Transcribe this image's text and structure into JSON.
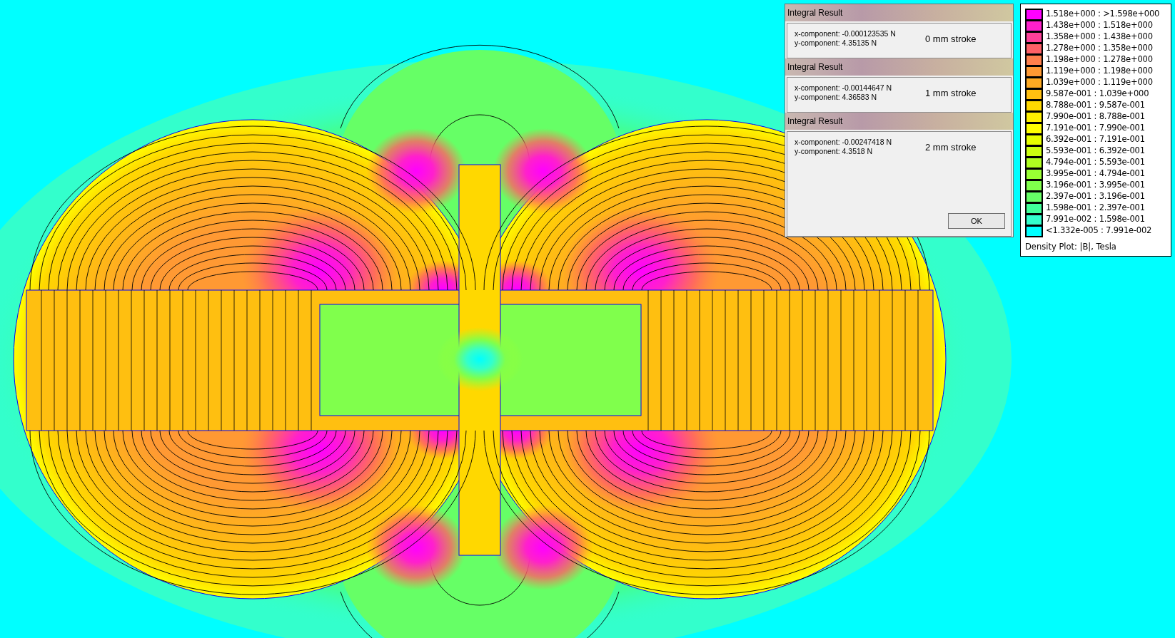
{
  "dialogs": [
    {
      "title": "Integral Result",
      "x_component": "x-component: -0.000123535 N",
      "y_component": "y-component: 4.35135 N",
      "note": "0 mm stroke"
    },
    {
      "title": "Integral Result",
      "x_component": "x-component: -0.00144647 N",
      "y_component": "y-component: 4.36583 N",
      "note": "1 mm stroke"
    },
    {
      "title": "Integral Result",
      "x_component": "x-component: -0.00247418 N",
      "y_component": "y-component: 4.3518 N",
      "note": "2 mm stroke",
      "button": "OK"
    }
  ],
  "legend": {
    "entries": [
      {
        "range": "1.518e+000 : >1.598e+000",
        "color": "#ff00ff"
      },
      {
        "range": "1.438e+000 : 1.518e+000",
        "color": "#ff20cc"
      },
      {
        "range": "1.358e+000 : 1.438e+000",
        "color": "#ff4099"
      },
      {
        "range": "1.278e+000 : 1.358e+000",
        "color": "#ff6066"
      },
      {
        "range": "1.198e+000 : 1.278e+000",
        "color": "#ff7f4c"
      },
      {
        "range": "1.119e+000 : 1.198e+000",
        "color": "#ff9933"
      },
      {
        "range": "1.039e+000 : 1.119e+000",
        "color": "#ffaa22"
      },
      {
        "range": "9.587e-001 : 1.039e+000",
        "color": "#ffbf10"
      },
      {
        "range": "8.788e-001 : 9.587e-001",
        "color": "#ffd800"
      },
      {
        "range": "7.990e-001 : 8.788e-001",
        "color": "#fff000"
      },
      {
        "range": "7.191e-001 : 7.990e-001",
        "color": "#ffff00"
      },
      {
        "range": "6.392e-001 : 7.191e-001",
        "color": "#e6ff00"
      },
      {
        "range": "5.593e-001 : 6.392e-001",
        "color": "#ccff10"
      },
      {
        "range": "4.794e-001 : 5.593e-001",
        "color": "#b0ff20"
      },
      {
        "range": "3.995e-001 : 4.794e-001",
        "color": "#99ff33"
      },
      {
        "range": "3.196e-001 : 3.995e-001",
        "color": "#80ff4c"
      },
      {
        "range": "2.397e-001 : 3.196e-001",
        "color": "#66ff66"
      },
      {
        "range": "1.598e-001 : 2.397e-001",
        "color": "#40ff99"
      },
      {
        "range": "7.991e-002 : 1.598e-001",
        "color": "#33ffcc"
      },
      {
        "range": "<1.332e-005 : 7.991e-002",
        "color": "#00ffff"
      }
    ],
    "caption": "Density Plot: |B|, Tesla"
  }
}
